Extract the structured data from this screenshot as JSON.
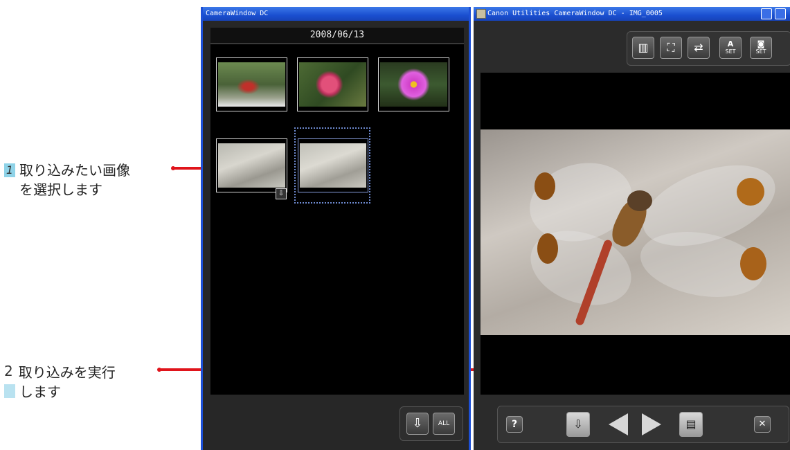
{
  "callouts": {
    "step1": {
      "num": "1",
      "line1": "取り込みたい画像",
      "line2": "を選択します"
    },
    "step2": {
      "num": "2",
      "line1": "取り込みを実行",
      "line2": "します"
    }
  },
  "left_window": {
    "title": "CameraWindow DC",
    "date": "2008/06/13",
    "thumbnails": [
      {
        "name": "red-bud-thumbnail",
        "selected": false
      },
      {
        "name": "pink-rose-thumbnail",
        "selected": false
      },
      {
        "name": "cosmos-flower-thumbnail",
        "selected": false
      },
      {
        "name": "dragonfly-thumbnail-1",
        "selected": false,
        "badge": "transfer-icon"
      },
      {
        "name": "dragonfly-thumbnail-2",
        "selected": true
      }
    ],
    "buttons": [
      {
        "name": "import-selected-icon"
      },
      {
        "name": "import-all-icon",
        "label": "ALL"
      }
    ]
  },
  "right_window": {
    "title": "Canon Utilities CameraWindow DC - IMG_0005",
    "toolbar_labels": {
      "set": "SET",
      "a": "A"
    },
    "toolbar_icons": [
      "layout-icon",
      "fullscreen-icon",
      "camera-transfer-icon",
      "auto-set-icon",
      "camera-set-icon"
    ],
    "bottom_labels": {
      "help": "?",
      "close": "✕"
    },
    "bottom_icons": [
      "help-icon",
      "import-icon",
      "previous-icon",
      "next-icon",
      "print-icon",
      "close-icon"
    ]
  },
  "colors": {
    "accent_red": "#e0141b",
    "callout_box": "#8fd3e8",
    "titlebar_blue": "#1a4fd0"
  }
}
